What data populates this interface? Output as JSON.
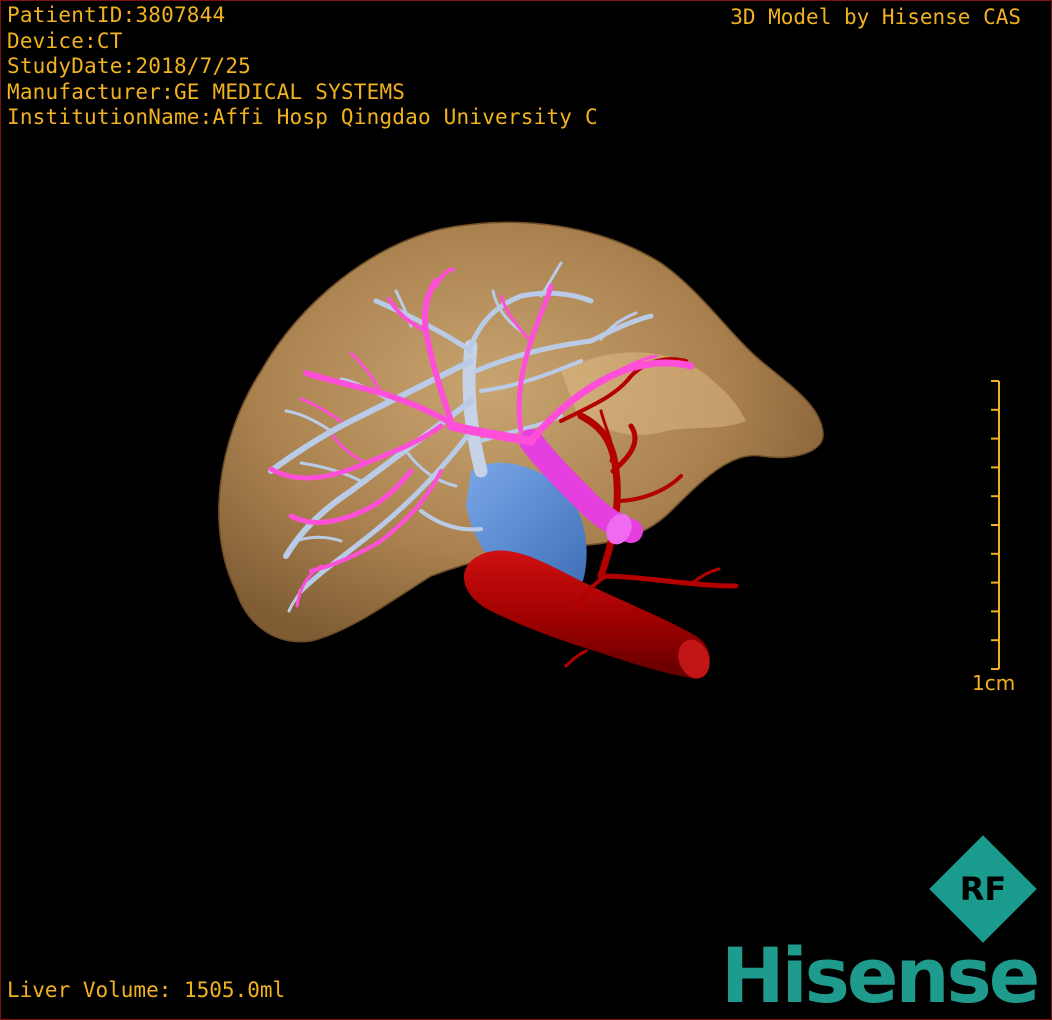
{
  "study_info": {
    "patient_id": "PatientID:3807844",
    "device": "Device:CT",
    "study_date": "StudyDate:2018/7/25",
    "manufacturer": "Manufacturer:GE MEDICAL SYSTEMS",
    "institution": "InstitutionName:Affi Hosp Qingdao University C"
  },
  "credit": "3D Model by Hisense CAS",
  "liver_volume": "Liver Volume: 1505.0ml",
  "scale": {
    "label": "1cm",
    "ticks": 11
  },
  "brand": {
    "name": "Hisense",
    "badge": "RF"
  },
  "colors": {
    "overlay_text": "#f2b21f",
    "liver": "#c79a5f",
    "portal_vein": "#b9cbe6",
    "hepatic_vein": "#ff4fd8",
    "vena_cava": "#5f90d8",
    "artery": "#b30000",
    "brand": "#1f9b8e",
    "border": "#7a1414"
  },
  "structures": [
    "liver",
    "portal-vein-tree",
    "hepatic-vein-tree",
    "vena-cava",
    "hepatic-artery",
    "aorta"
  ]
}
